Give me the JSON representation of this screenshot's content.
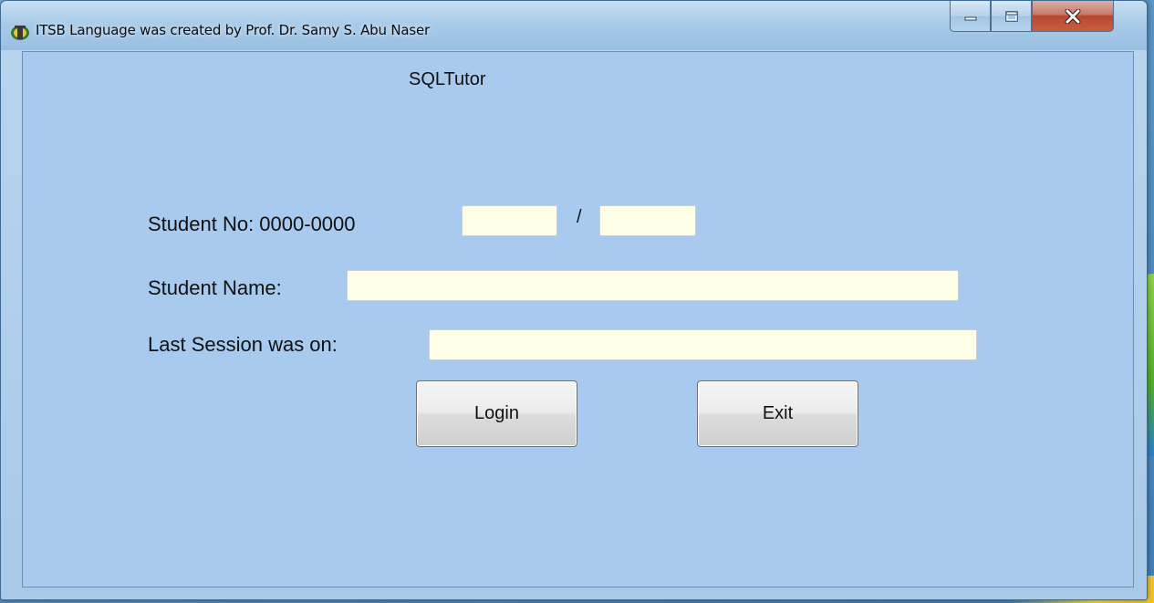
{
  "window": {
    "title": "ITSB Language was created by Prof. Dr. Samy S. Abu Naser",
    "app_icon": "itsb-app-icon",
    "controls": [
      "minimize-icon",
      "maximize-icon",
      "close-icon"
    ]
  },
  "form": {
    "heading": "SQLTutor",
    "student_no_label": "Student No: 0000-0000",
    "student_no_part1": "",
    "separator": "/",
    "student_no_part2": "",
    "student_name_label": "Student Name:",
    "student_name_value": "",
    "last_session_label": "Last Session was on:",
    "last_session_value": "",
    "login_label": "Login",
    "exit_label": "Exit"
  },
  "colors": {
    "client_background": "#a7caee",
    "input_background": "#fffee6"
  }
}
